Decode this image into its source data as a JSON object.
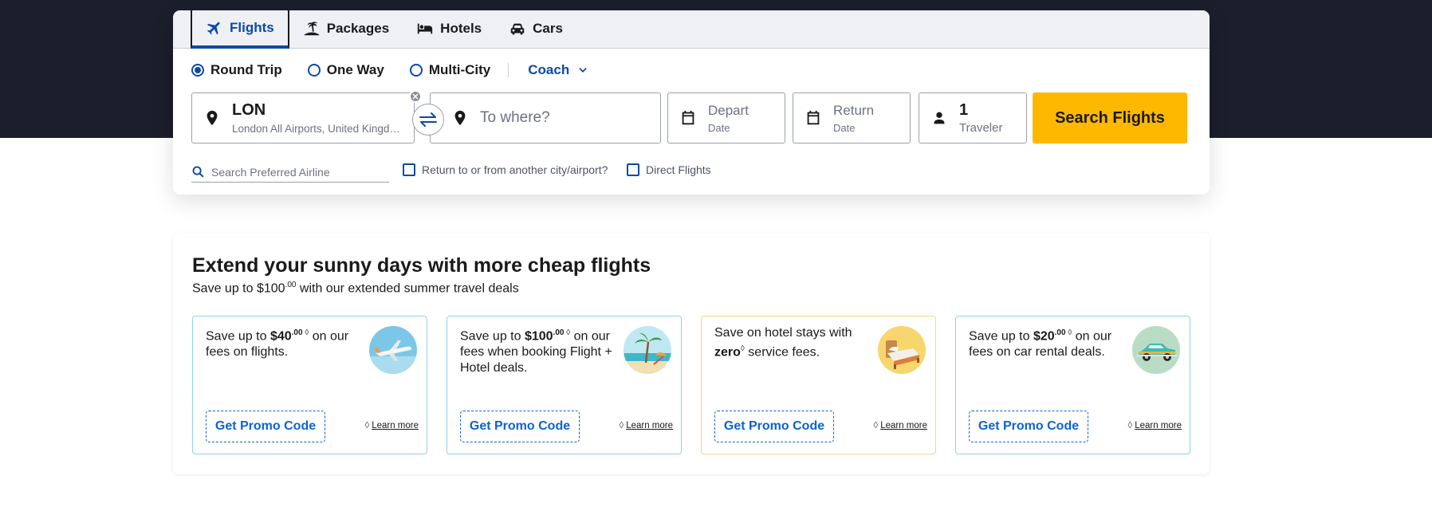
{
  "colors": {
    "brand_blue": "#0b4aa6",
    "search_yellow": "#ffb800",
    "hero_dark": "#1b1e2b"
  },
  "tabs": [
    {
      "label": "Flights",
      "icon": "plane-icon",
      "active": true
    },
    {
      "label": "Packages",
      "icon": "palm-island-icon",
      "active": false
    },
    {
      "label": "Hotels",
      "icon": "bed-icon",
      "active": false
    },
    {
      "label": "Cars",
      "icon": "car-icon",
      "active": false
    }
  ],
  "trip_options": {
    "round_trip": "Round Trip",
    "one_way": "One Way",
    "multi_city": "Multi-City",
    "selected": "Round Trip",
    "cabin": "Coach"
  },
  "from": {
    "code": "LON",
    "detail": "London All Airports, United Kingdom"
  },
  "to": {
    "placeholder": "To where?"
  },
  "depart": {
    "label": "Depart",
    "sub": "Date"
  },
  "return": {
    "label": "Return",
    "sub": "Date"
  },
  "travelers": {
    "count": "1",
    "label": "Traveler"
  },
  "search_button": "Search Flights",
  "airline_search": {
    "placeholder": "Search Preferred Airline"
  },
  "checkboxes": {
    "other_city": "Return to or from another city/airport?",
    "direct": "Direct Flights"
  },
  "promo": {
    "title": "Extend your sunny days with more cheap flights",
    "subtitle_pre": "Save up to $100",
    "subtitle_cents": ".00",
    "subtitle_post": " with our extended summer travel deals",
    "cards": [
      {
        "pre": "Save up to ",
        "amount": "$40",
        "cents": ".00",
        "mark": "◊",
        "post": " on our fees on flights.",
        "thumb": "airplane-icon",
        "button": "Get Promo Code",
        "learn": "Learn more"
      },
      {
        "pre": "Save up to ",
        "amount": "$100",
        "cents": ".00",
        "mark": "◊",
        "post": " on our fees when booking Flight + Hotel deals.",
        "thumb": "beach-icon",
        "button": "Get Promo Code",
        "learn": "Learn more"
      },
      {
        "pre": "Save on hotel stays with ",
        "amount": "zero",
        "cents": "",
        "mark": "◊",
        "post": " service fees.",
        "thumb": "bed-icon",
        "button": "Get Promo Code",
        "learn": "Learn more"
      },
      {
        "pre": "Save up to ",
        "amount": "$20",
        "cents": ".00",
        "mark": "◊",
        "post": " on our fees on car rental deals.",
        "thumb": "vintage-car-icon",
        "button": "Get Promo Code",
        "learn": "Learn more"
      }
    ],
    "diamond": "◊"
  }
}
